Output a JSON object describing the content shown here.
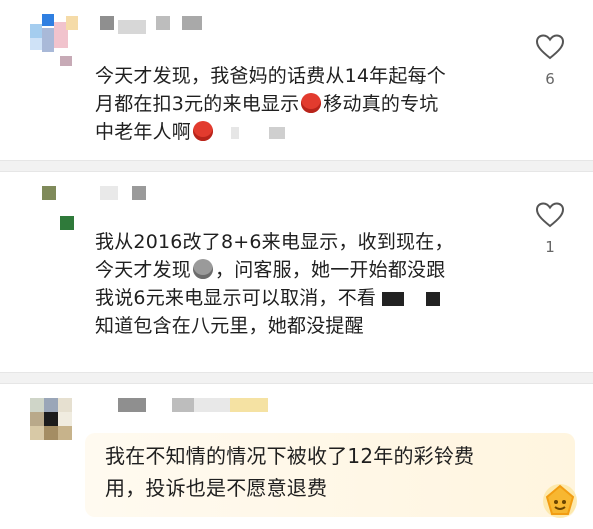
{
  "comments": [
    {
      "lines": [
        "今天才发现，我爸妈的话费从14年起每个",
        "月都在扣3元的来电显示",
        "移动真的专坑",
        "中老年人啊"
      ],
      "likes": "6",
      "heart_icon": "heart-outline-icon",
      "emoji": "angry-devil-emoji"
    },
    {
      "lines": [
        "我从2016改了8+6来电显示，收到现在，",
        "今天才发现",
        "，问客服，她一开始都没跟",
        "我说6元来电显示可以取消，不看",
        "知道包含在八元里，她都没提醒"
      ],
      "likes": "1",
      "heart_icon": "heart-outline-icon",
      "emoji": "grey-face-emoji"
    },
    {
      "lines": [
        "我在不知情的情况下被收了12年的彩铃费",
        "用，投诉也是不愿意退费"
      ]
    }
  ],
  "colors": {
    "divider": "#f2f2f2",
    "highlight": "#fff5df"
  }
}
